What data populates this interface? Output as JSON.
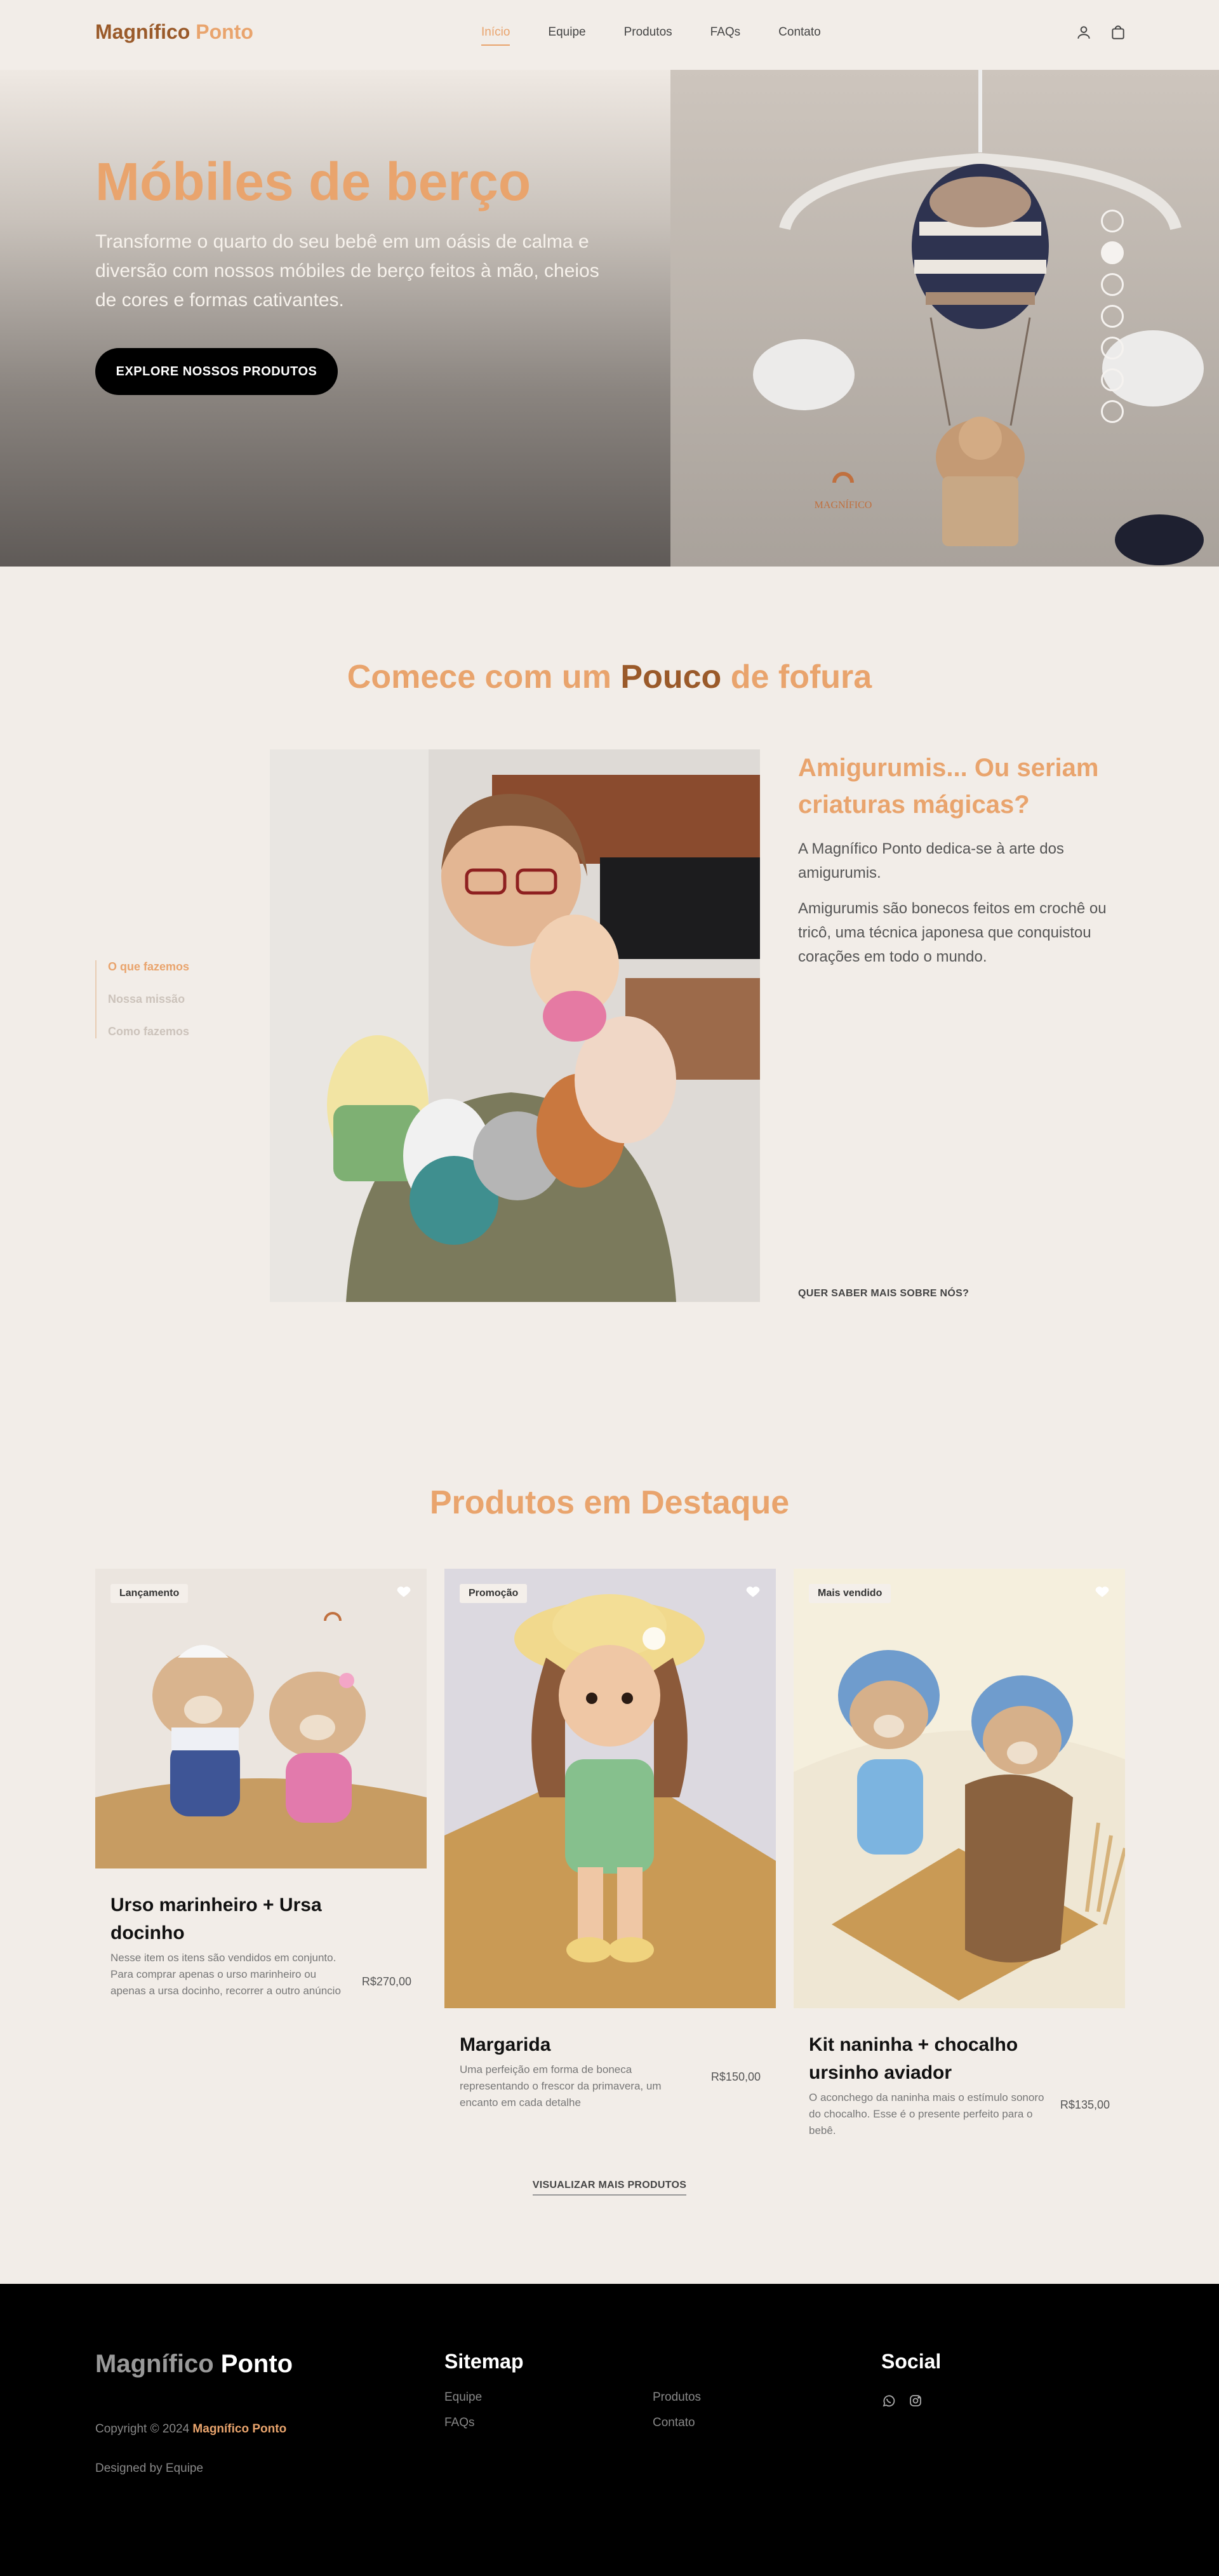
{
  "header": {
    "logo_part1": "Magnífico",
    "logo_part2": "Ponto",
    "nav": [
      "Início",
      "Equipe",
      "Produtos",
      "FAQs",
      "Contato"
    ],
    "active_nav": "Início",
    "icons": [
      "user-icon",
      "shopping-bag-icon"
    ]
  },
  "hero": {
    "title": "Móbiles de berço",
    "text": "Transforme o quarto do seu bebê em um oásis de calma e diversão com nossos móbiles de berço feitos à mão, cheios de cores e formas cativantes.",
    "cta": "EXPLORE NOSSOS PRODUTOS",
    "photo_brand_text": "MAGNÍFICO",
    "slides_count": 7,
    "active_slide": 2
  },
  "about": {
    "title_part1": "Comece com um",
    "title_part2": "Pouco",
    "title_part3": "de fofura",
    "side_nav": [
      "O que fazemos",
      "Nossa missão",
      "Como fazemos"
    ],
    "heading": "Amigurumis... Ou seriam criaturas mágicas?",
    "p1": "A Magnífico Ponto dedica-se à arte dos amigurumis.",
    "p2": "Amigurumis são bonecos feitos em crochê ou tricô, uma técnica japonesa que conquistou corações em todo o mundo.",
    "link": "QUER SABER MAIS SOBRE NÓS?"
  },
  "products": {
    "title": "Produtos em Destaque",
    "items": [
      {
        "badge": "Lançamento",
        "name": "Urso marinheiro + Ursa docinho",
        "desc": "Nesse item os itens são vendidos em conjunto. Para comprar apenas o urso marinheiro ou apenas a ursa docinho, recorrer a outro anúncio",
        "price": "R$270,00"
      },
      {
        "badge": "Promoção",
        "name": "Margarida",
        "desc": "Uma perfeição em forma de boneca representando o frescor da primavera, um encanto em cada detalhe",
        "price": "R$150,00"
      },
      {
        "badge": "Mais vendido",
        "name": "Kit naninha + chocalho ursinho aviador",
        "desc": "O aconchego da naninha mais o estímulo sonoro do chocalho. Esse é o presente perfeito para o bebê.",
        "price": "R$135,00"
      }
    ],
    "more_link": "VISUALIZAR MAIS PRODUTOS"
  },
  "footer": {
    "logo_part1": "Magnífico",
    "logo_part2": "Ponto",
    "copyright": "Copyright © 2024",
    "copyright_brand": "Magnífico Ponto",
    "designed": "Designed by Equipe",
    "sitemap_title": "Sitemap",
    "sitemap": [
      "Equipe",
      "FAQs",
      "Produtos",
      "Contato"
    ],
    "social_title": "Social",
    "social_icons": [
      "whatsapp-icon",
      "instagram-icon"
    ]
  },
  "colors": {
    "accent": "#e9a46d",
    "brand_dark": "#9a5a2a",
    "background": "#f2ede8",
    "footer": "#000000"
  }
}
